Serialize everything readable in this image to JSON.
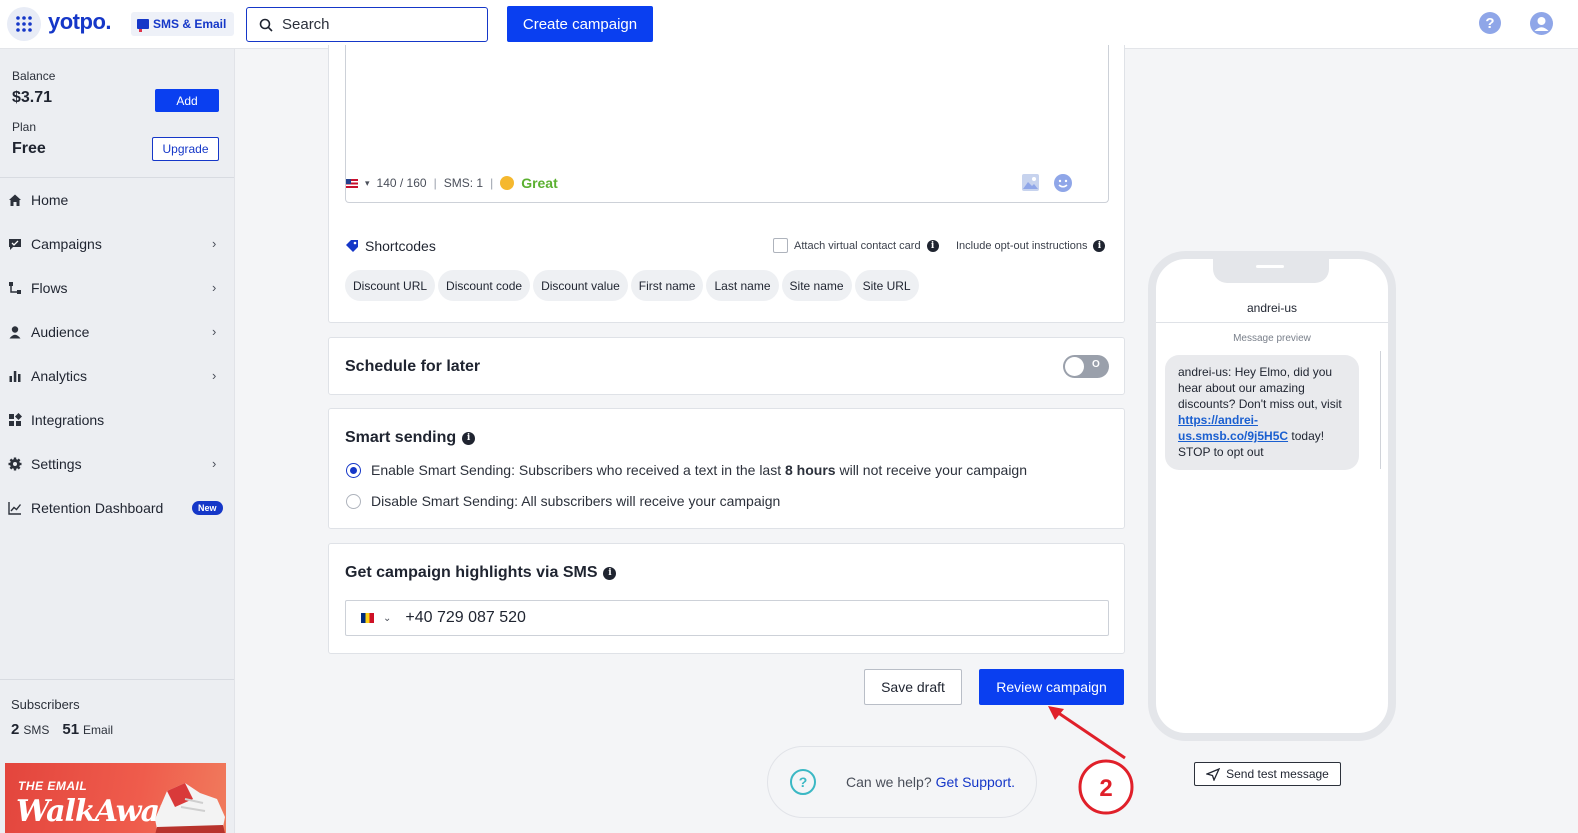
{
  "topbar": {
    "logo": "yotpo.",
    "product": "SMS & Email",
    "search_placeholder": "Search",
    "create_campaign": "Create campaign",
    "help": "?"
  },
  "sidebar": {
    "balance_label": "Balance",
    "balance_value": "$3.71",
    "add": "Add",
    "plan_label": "Plan",
    "plan_value": "Free",
    "upgrade": "Upgrade",
    "nav": [
      {
        "label": "Home",
        "icon": "home-icon"
      },
      {
        "label": "Campaigns",
        "icon": "campaigns-icon"
      },
      {
        "label": "Flows",
        "icon": "flows-icon"
      },
      {
        "label": "Audience",
        "icon": "audience-icon"
      },
      {
        "label": "Analytics",
        "icon": "analytics-icon"
      },
      {
        "label": "Integrations",
        "icon": "integrations-icon"
      },
      {
        "label": "Settings",
        "icon": "settings-icon"
      },
      {
        "label": "Retention Dashboard",
        "icon": "retention-icon",
        "badge": "New"
      }
    ],
    "subscribers_label": "Subscribers",
    "sms_count": "2",
    "sms_unit": "SMS",
    "email_count": "51",
    "email_unit": "Email",
    "promo_line1": "THE EMAIL",
    "promo_line2": "WalkAway"
  },
  "message": {
    "char_count": "140 / 160",
    "sms_count": "SMS: 1",
    "quality": "Great",
    "shortcodes_label": "Shortcodes",
    "attach_vcard": "Attach virtual contact card",
    "opt_out": "Include opt-out instructions",
    "chips": [
      "Discount URL",
      "Discount code",
      "Discount value",
      "First name",
      "Last name",
      "Site name",
      "Site URL"
    ]
  },
  "schedule": {
    "title": "Schedule for later",
    "toggle_state": "O"
  },
  "smart_sending": {
    "title": "Smart sending",
    "enable_pre": "Enable Smart Sending: Subscribers who received a text in the last ",
    "enable_bold": "8 hours",
    "enable_post": " will not receive your campaign",
    "disable": "Disable Smart Sending: All subscribers will receive your campaign"
  },
  "highlights": {
    "title": "Get campaign highlights via SMS",
    "phone": "+40 729 087 520"
  },
  "actions": {
    "save_draft": "Save draft",
    "review_campaign": "Review campaign"
  },
  "support": {
    "question": "Can we help?",
    "link": "Get Support."
  },
  "annotation": {
    "number": "2"
  },
  "preview": {
    "sender": "andrei-us",
    "label": "Message preview",
    "msg_pre": "andrei-us: Hey Elmo, did you hear about our amazing discounts? Don't miss out, visit ",
    "msg_link": "https://andrei-us.smsb.co/9j5H5C",
    "msg_post": " today! STOP to opt out",
    "send_test": "Send test message"
  },
  "colors": {
    "brand": "#1537c8",
    "primary_button": "#0a3ff0",
    "great": "#5bb030",
    "annotation": "#e0202a"
  }
}
